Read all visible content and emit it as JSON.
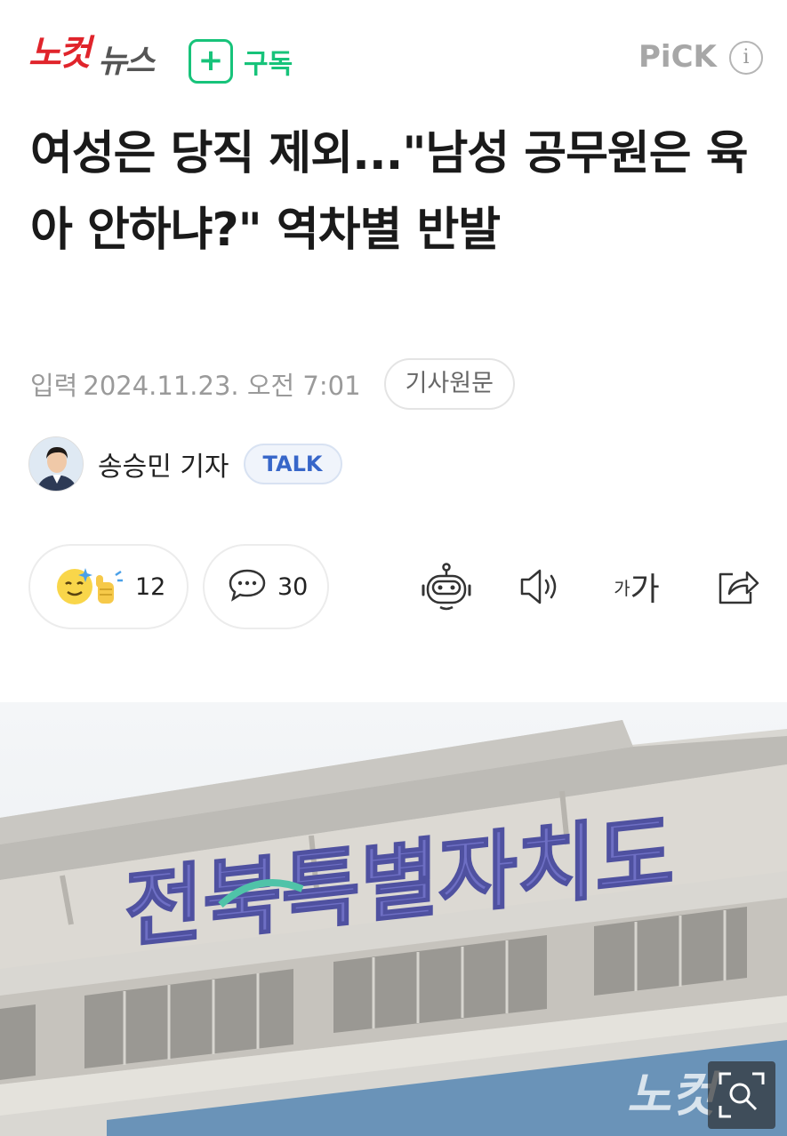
{
  "header": {
    "logo_main": "노컷",
    "logo_sub": "뉴스",
    "subscribe_icon": "+",
    "subscribe_label": "구독",
    "pick_label": "PiCK",
    "info_icon": "i"
  },
  "article": {
    "headline": "여성은 당직 제외...\"남성 공무원은 육아 안하냐?\" 역차별 반발",
    "date_label": "입력",
    "date": "2024.11.23. 오전 7:01",
    "original_button": "기사원문",
    "reporter_name": "송승민 기자",
    "talk_label": "TALK"
  },
  "actions": {
    "reaction_count": "12",
    "comment_count": "30",
    "font_small": "가",
    "font_big": "가"
  },
  "photo": {
    "sign_text": "전북특별자치도",
    "watermark": "노컷"
  },
  "icons": {
    "info": "info-icon",
    "reaction": "reaction-emoji-icon",
    "comment": "comment-bubble-icon",
    "robot": "robot-icon",
    "speaker": "speaker-icon",
    "share": "share-icon",
    "zoom": "zoom-icon"
  },
  "colors": {
    "brand_red": "#e0242b",
    "subscribe_green": "#17c37a",
    "talk_blue": "#3766c9",
    "sign_purple": "#6e6fc4"
  }
}
